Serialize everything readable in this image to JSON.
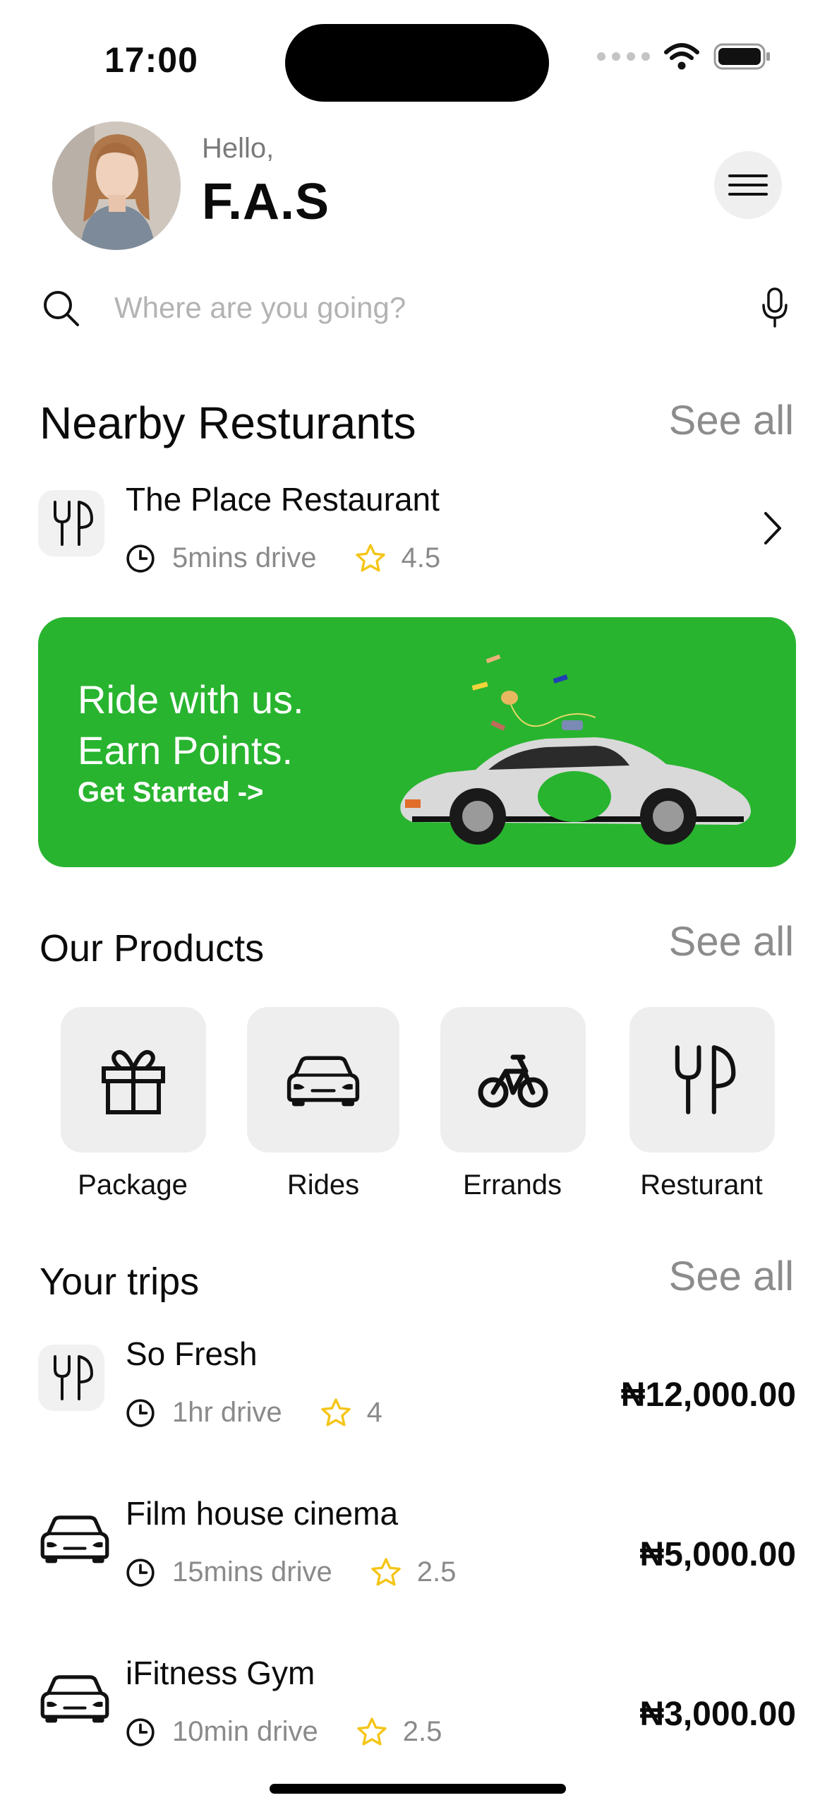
{
  "status_bar": {
    "time": "17:00"
  },
  "header": {
    "greeting": "Hello,",
    "username": "F.A.S"
  },
  "search": {
    "placeholder": "Where are you going?"
  },
  "nearby": {
    "title": "Nearby Resturants",
    "see_all": "See all",
    "items": [
      {
        "name": "The Place Restaurant",
        "time": "5mins drive",
        "rating": "4.5"
      }
    ]
  },
  "banner": {
    "line1": "Ride with us.",
    "line2": "Earn Points.",
    "cta": "Get Started ->",
    "background": "#28b42f"
  },
  "products": {
    "title": "Our Products",
    "see_all": "See all",
    "items": [
      {
        "label": "Package",
        "icon": "gift-icon"
      },
      {
        "label": "Rides",
        "icon": "car-icon"
      },
      {
        "label": "Errands",
        "icon": "bicycle-icon"
      },
      {
        "label": "Resturant",
        "icon": "utensils-icon"
      }
    ]
  },
  "trips": {
    "title": "Your trips",
    "see_all": "See all",
    "items": [
      {
        "name": "So Fresh",
        "time": "1hr drive",
        "rating": "4",
        "price": "₦12,000.00",
        "icon": "utensils-icon"
      },
      {
        "name": "Film house cinema",
        "time": "15mins drive",
        "rating": "2.5",
        "price": "₦5,000.00",
        "icon": "car-icon"
      },
      {
        "name": "iFitness Gym",
        "time": "10min drive",
        "rating": "2.5",
        "price": "₦3,000.00",
        "icon": "car-icon"
      }
    ]
  },
  "colors": {
    "accent": "#28b42f",
    "star": "#f5c518",
    "muted": "#8a8a8a"
  }
}
